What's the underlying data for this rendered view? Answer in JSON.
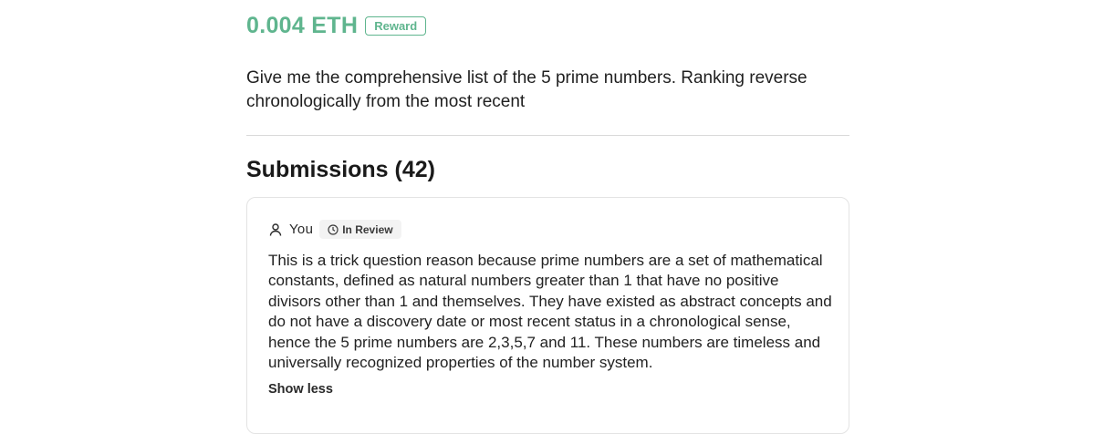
{
  "reward": {
    "amount": "0.004 ETH",
    "badge_label": "Reward",
    "accent_color": "#5fb58e"
  },
  "question": {
    "text": "Give me the comprehensive list of the 5 prime numbers. Ranking reverse chronologically from the most recent"
  },
  "submissions": {
    "heading": "Submissions (42)",
    "items": [
      {
        "author": "You",
        "author_icon": "user-icon",
        "status_icon": "clock-icon",
        "status": "In Review",
        "answer": "This is a trick question reason because prime numbers are a set of mathematical constants, defined as natural numbers greater than 1 that have no positive divisors other than 1 and themselves. They have existed as abstract concepts and do not have a discovery date or most recent status in a chronological sense, hence the 5 prime numbers are 2,3,5,7 and 11. These numbers are timeless and universally recognized properties of the number system.",
        "toggle_label": "Show less"
      }
    ]
  }
}
